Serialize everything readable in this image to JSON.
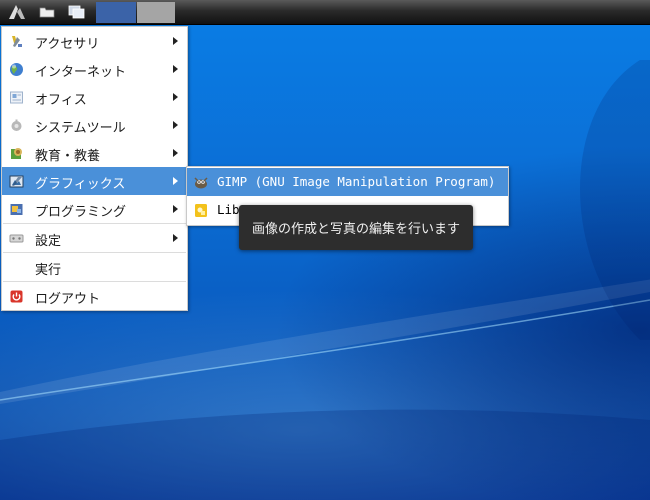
{
  "panel": {
    "buttons": [
      {
        "name": "app-menu-button",
        "icon": "menu-logo-icon"
      },
      {
        "name": "file-manager-button",
        "icon": "folder-icon"
      },
      {
        "name": "show-desktop-button",
        "icon": "windows-icon"
      }
    ],
    "taskbar": [
      {
        "name": "workspace-1",
        "color": "#3b63a8"
      },
      {
        "name": "workspace-2",
        "color": "#a5a5a5"
      }
    ]
  },
  "menu": {
    "items": [
      {
        "label": "アクセサリ",
        "icon": "accessories-icon",
        "has_submenu": true
      },
      {
        "label": "インターネット",
        "icon": "internet-globe-icon",
        "has_submenu": true
      },
      {
        "label": "オフィス",
        "icon": "office-icon",
        "has_submenu": true
      },
      {
        "label": "システムツール",
        "icon": "system-tools-icon",
        "has_submenu": true
      },
      {
        "label": "教育・教養",
        "icon": "education-icon",
        "has_submenu": true
      },
      {
        "label": "グラフィックス",
        "icon": "graphics-icon",
        "has_submenu": true,
        "active": true
      },
      {
        "label": "プログラミング",
        "icon": "programming-icon",
        "has_submenu": true
      },
      {
        "label": "設定",
        "icon": "settings-icon",
        "has_submenu": true
      },
      {
        "label": "実行",
        "icon": "",
        "has_submenu": false
      },
      {
        "label": "ログアウト",
        "icon": "logout-icon",
        "has_submenu": false
      }
    ]
  },
  "submenu": {
    "items": [
      {
        "label": "GIMP (GNU Image Manipulation Program)",
        "icon": "gimp-icon",
        "active": true
      },
      {
        "label": "Lib",
        "icon": "libreoffice-draw-icon",
        "active": false
      }
    ]
  },
  "tooltip": {
    "text": "画像の作成と写真の編集を行います"
  },
  "colors": {
    "highlight": "#4a90d9",
    "desktop": "#0b6fd6"
  }
}
